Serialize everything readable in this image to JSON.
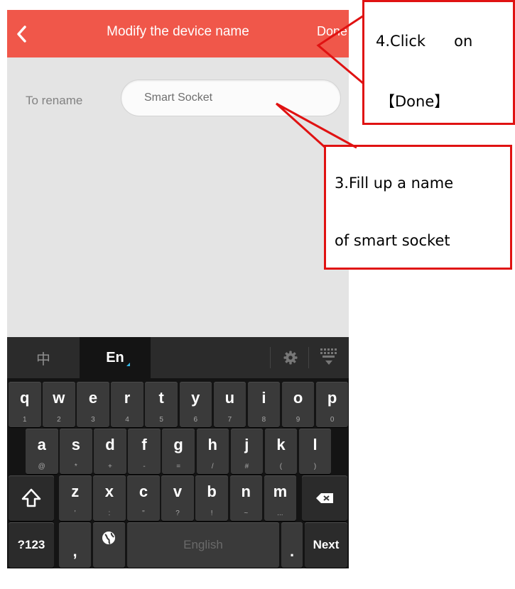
{
  "header": {
    "back_icon": "chevron-left-icon",
    "title": "Modify the device name",
    "done_label": "Done",
    "background_color": "#f0574a"
  },
  "form": {
    "rename_label": "To rename",
    "name_value": "Smart Socket"
  },
  "keyboard": {
    "tabs": [
      "中",
      "En"
    ],
    "settings_icon": "gear-icon",
    "hide_icon": "keyboard-hide-icon",
    "row1": [
      {
        "k": "q",
        "s": "1"
      },
      {
        "k": "w",
        "s": "2"
      },
      {
        "k": "e",
        "s": "3"
      },
      {
        "k": "r",
        "s": "4"
      },
      {
        "k": "t",
        "s": "5"
      },
      {
        "k": "y",
        "s": "6"
      },
      {
        "k": "u",
        "s": "7"
      },
      {
        "k": "i",
        "s": "8"
      },
      {
        "k": "o",
        "s": "9"
      },
      {
        "k": "p",
        "s": "0"
      }
    ],
    "row2": [
      {
        "k": "a",
        "s": "@"
      },
      {
        "k": "s",
        "s": "*"
      },
      {
        "k": "d",
        "s": "+"
      },
      {
        "k": "f",
        "s": "-"
      },
      {
        "k": "g",
        "s": "="
      },
      {
        "k": "h",
        "s": "/"
      },
      {
        "k": "j",
        "s": "#"
      },
      {
        "k": "k",
        "s": "("
      },
      {
        "k": "l",
        "s": ")"
      }
    ],
    "row3": [
      {
        "k": "z",
        "s": "'"
      },
      {
        "k": "x",
        "s": ":"
      },
      {
        "k": "c",
        "s": "\""
      },
      {
        "k": "v",
        "s": "?"
      },
      {
        "k": "b",
        "s": "!"
      },
      {
        "k": "n",
        "s": "~"
      },
      {
        "k": "m",
        "s": "..."
      }
    ],
    "bottom": {
      "symbols_label": "?123",
      "comma_label": ",",
      "space_label": "English",
      "period_label": ".",
      "next_label": "Next"
    }
  },
  "annotations": {
    "step4": [
      "4.Click      on",
      "【Done】"
    ],
    "step3": [
      "3.Fill up a name",
      "of smart socket"
    ],
    "color": "#e01212"
  }
}
